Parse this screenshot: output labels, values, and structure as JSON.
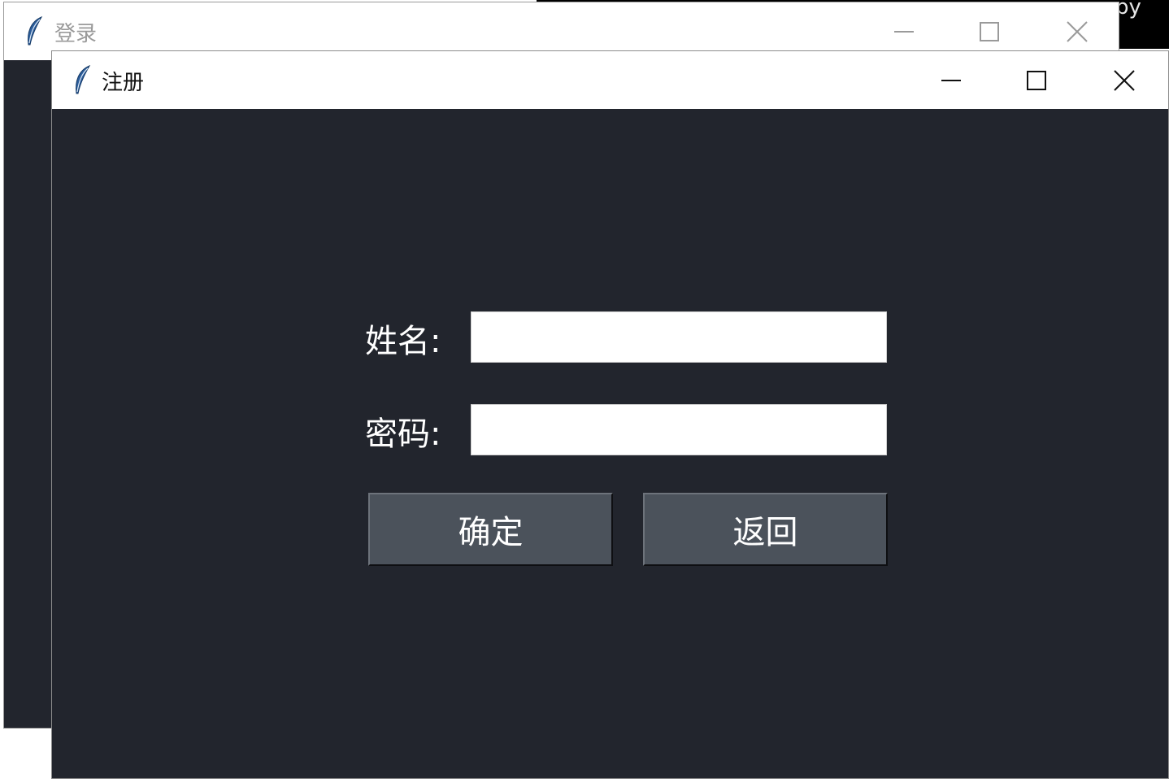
{
  "background": {
    "partial_text": "py"
  },
  "login_window": {
    "title": "登录",
    "icon": "tk-feather-icon"
  },
  "register_window": {
    "title": "注册",
    "icon": "tk-feather-icon",
    "form": {
      "name_label": "姓名:",
      "name_value": "",
      "password_label": "密码:",
      "password_value": ""
    },
    "buttons": {
      "confirm": "确定",
      "back": "返回"
    }
  },
  "colors": {
    "window_bg": "#22252d",
    "button_bg": "#4b525b",
    "titlebar_bg": "#ffffff",
    "label_text": "#ffffff"
  }
}
